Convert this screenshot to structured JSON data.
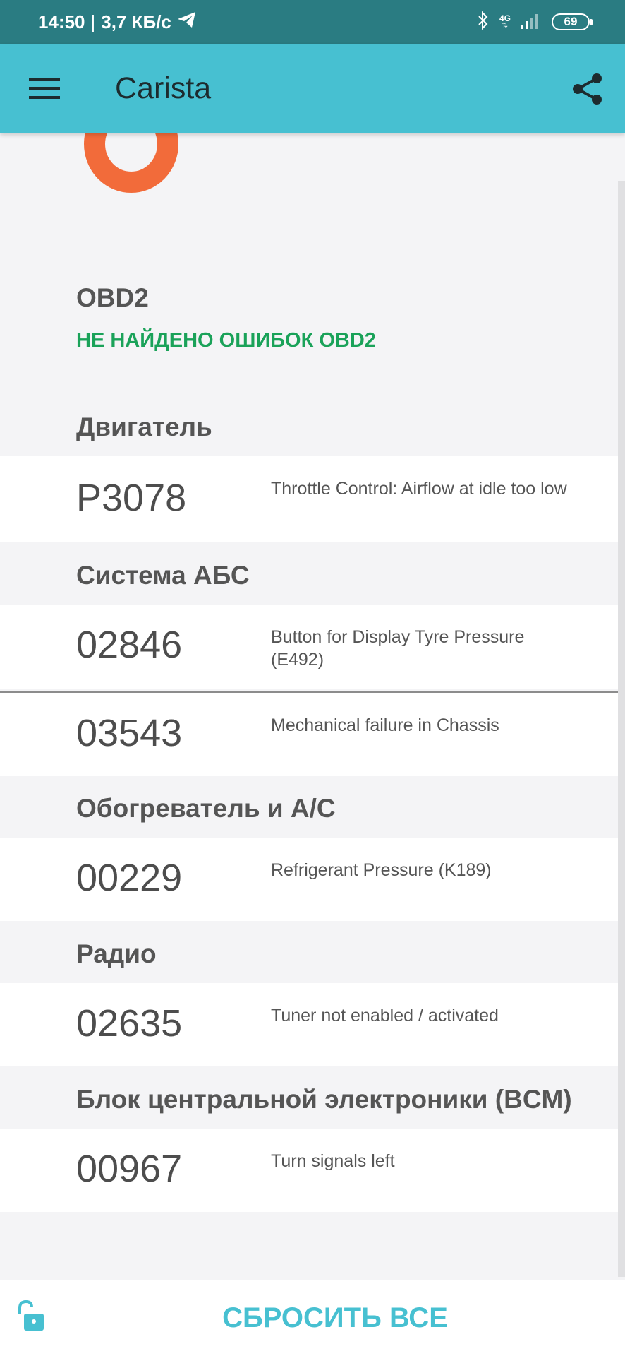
{
  "status_bar": {
    "time": "14:50",
    "speed": "3,7 КБ/с",
    "network": "4G",
    "battery": "69"
  },
  "app_bar": {
    "title": "Carista"
  },
  "obd2": {
    "title": "OBD2",
    "status": "НЕ НАЙДЕНО ОШИБОК OBD2"
  },
  "sections": [
    {
      "title": "Двигатель",
      "faults": [
        {
          "code": "P3078",
          "description": "Throttle Control: Airflow at idle too low"
        }
      ]
    },
    {
      "title": "Система АБС",
      "faults": [
        {
          "code": "02846",
          "description": "Button for Display Tyre Pressure (E492)"
        },
        {
          "code": "03543",
          "description": "Mechanical failure in Chassis"
        }
      ]
    },
    {
      "title": "Обогреватель и A/C",
      "faults": [
        {
          "code": "00229",
          "description": "Refrigerant Pressure (K189)"
        }
      ]
    },
    {
      "title": "Радио",
      "faults": [
        {
          "code": "02635",
          "description": "Tuner not enabled / activated"
        }
      ]
    },
    {
      "title": "Блок центральной электроники (BCM)",
      "faults": [
        {
          "code": "00967",
          "description": "Turn signals left"
        }
      ]
    }
  ],
  "bottom_bar": {
    "reset_label": "СБРОСИТЬ ВСЕ"
  },
  "colors": {
    "status_bar": "#2a7c82",
    "app_bar": "#47c0d1",
    "accent": "#47c0d1",
    "ok_green": "#1aa259",
    "logo_orange": "#f26b3a"
  }
}
